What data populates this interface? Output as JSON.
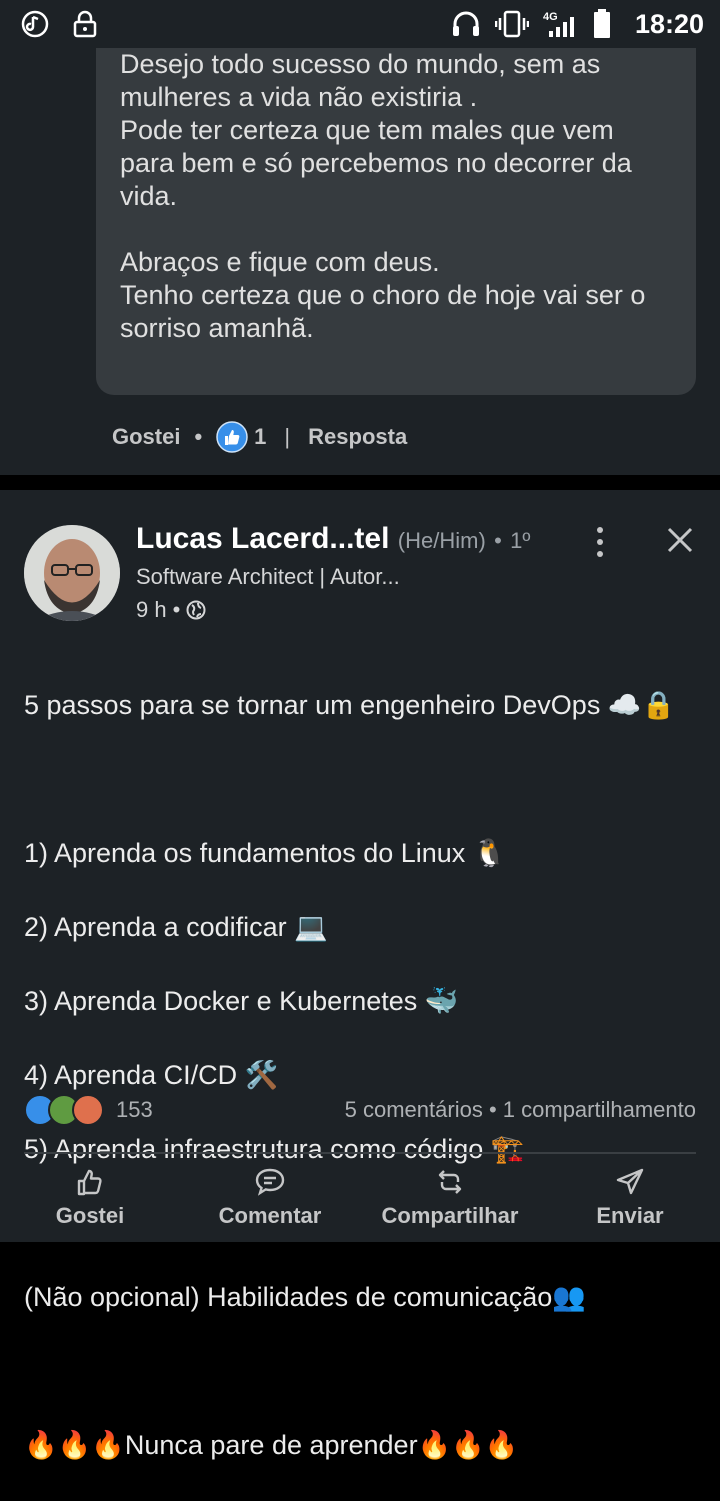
{
  "status_bar": {
    "time": "18:20",
    "network": "4G"
  },
  "comment": {
    "text": "Desejo todo sucesso do mundo, sem as\nmulheres a vida não existiria .\nPode ter certeza que tem males que vem\npara bem e só percebemos no decorrer da\nvida.\n\nAbraços e fique com deus.\nTenho certeza que o choro de hoje vai ser o\nsorriso amanhã.",
    "like_label": "Gostei",
    "like_count": "1",
    "reply_label": "Resposta"
  },
  "post": {
    "author_name": "Lucas Lacerd...tel",
    "author_pronouns": "(He/Him)",
    "author_degree": "1º",
    "author_headline": "Software Architect | Autor...",
    "time": "9 h",
    "body_lines": [
      "5 passos para se tornar um engenheiro DevOps ☁️🔒",
      "",
      "1) Aprenda os fundamentos do Linux 🐧",
      "2) Aprenda a codificar 💻",
      "3) Aprenda Docker e Kubernetes 🐳",
      "4) Aprenda CI/CD 🛠️",
      "5) Aprenda infraestrutura como código 🏗️",
      "",
      "(Não opcional) Habilidades de comunicação👥",
      "",
      "🔥🔥🔥Nunca pare de aprender🔥🔥🔥"
    ],
    "reaction_count": "153",
    "comments_count": "5 comentários",
    "shares_count": "1 compartilhamento",
    "actions": {
      "like": "Gostei",
      "comment": "Comentar",
      "share": "Compartilhar",
      "send": "Enviar"
    }
  },
  "colors": {
    "background": "#1d2226",
    "bubble": "#363b3f",
    "like_blue": "#378fe9",
    "celebrate_green": "#5f9b41",
    "love_red": "#df704d"
  }
}
